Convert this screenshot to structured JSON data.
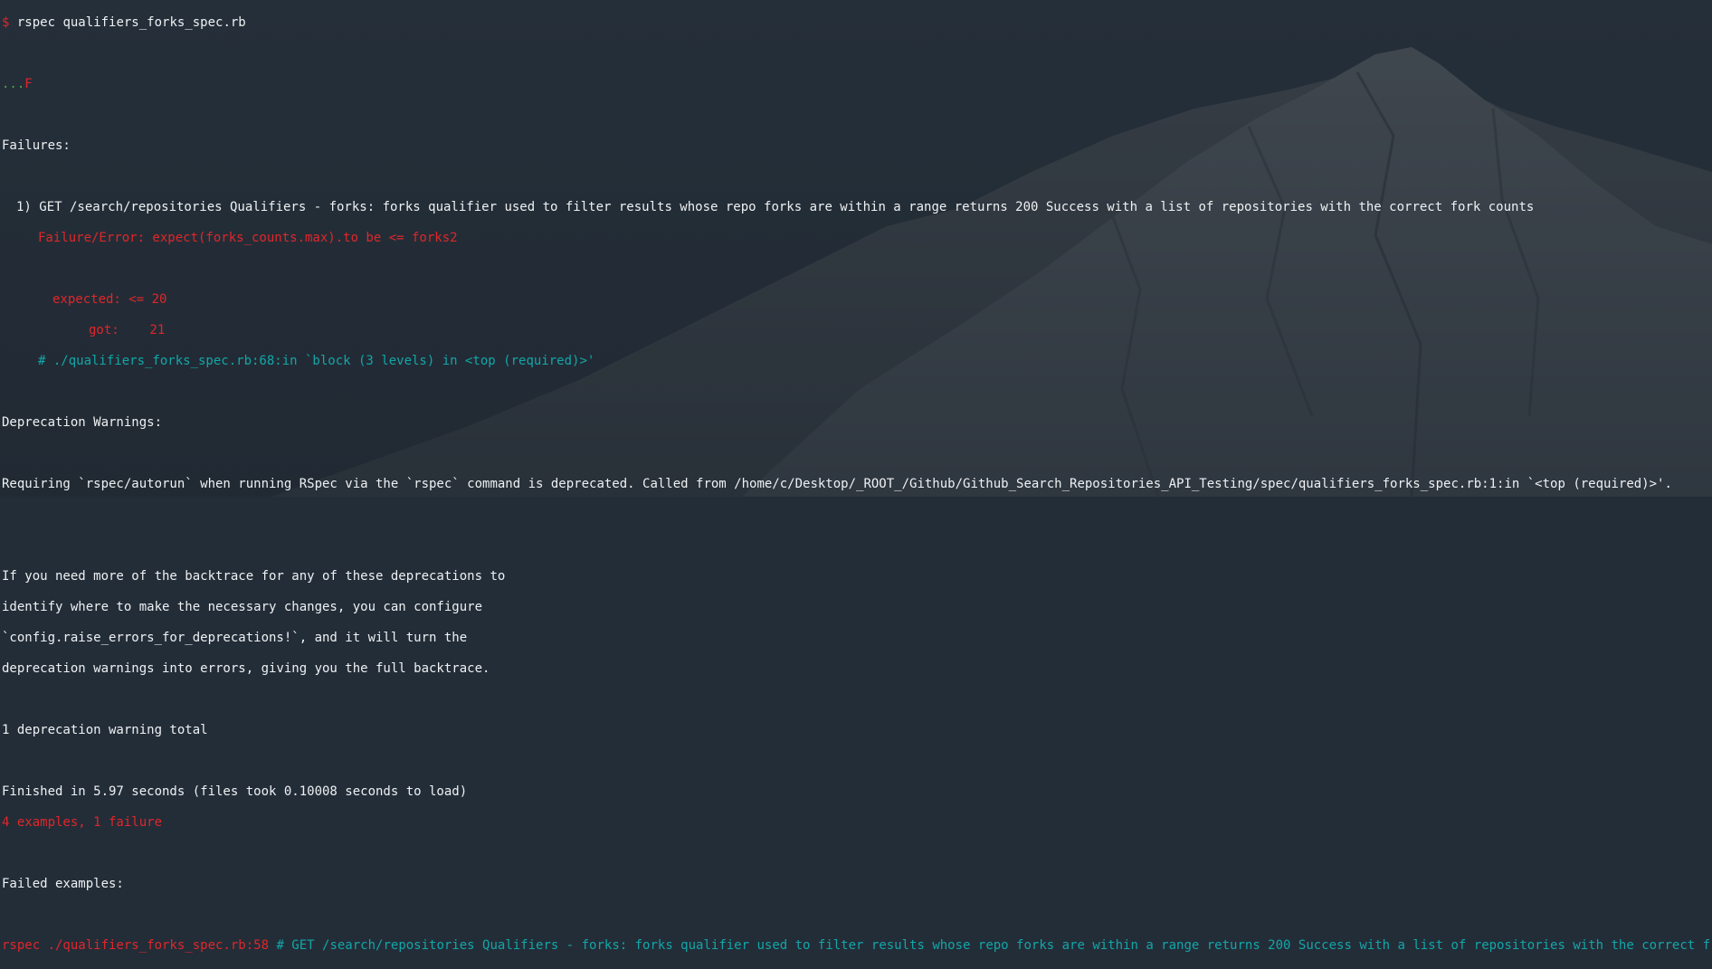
{
  "terminal": {
    "prompt": "$",
    "command": "rspec qualifiers_forks_spec.rb",
    "progress_pass": "...",
    "progress_fail": "F",
    "failures_heading": "Failures:",
    "failure": {
      "title": "1) GET /search/repositories Qualifiers - forks: forks qualifier used to filter results whose repo forks are within a range returns 200 Success with a list of repositories with the correct fork counts",
      "error": "Failure/Error: expect(forks_counts.max).to be <= forks2",
      "expected": "expected: <= 20",
      "got": "got:    21",
      "trace": "# ./qualifiers_forks_spec.rb:68:in `block (3 levels) in <top (required)>'"
    },
    "deprecation_heading": "Deprecation Warnings:",
    "deprecation_message": "Requiring `rspec/autorun` when running RSpec via the `rspec` command is deprecated. Called from /home/c/Desktop/_ROOT_/Github/Github_Search_Repositories_API_Testing/spec/qualifiers_forks_spec.rb:1:in `<top (required)>'.",
    "backtrace_help": [
      "If you need more of the backtrace for any of these deprecations to",
      "identify where to make the necessary changes, you can configure",
      "`config.raise_errors_for_deprecations!`, and it will turn the",
      "deprecation warnings into errors, giving you the full backtrace."
    ],
    "deprecation_total": "1 deprecation warning total",
    "finished": "Finished in 5.97 seconds (files took 0.10008 seconds to load)",
    "summary": "4 examples, 1 failure",
    "failed_examples_heading": "Failed examples:",
    "rerun_command": "rspec ./qualifiers_forks_spec.rb:58",
    "rerun_comment": "# GET /search/repositories Qualifiers - forks: forks qualifier used to filter results whose repo forks are within a range returns 200 Success with a list of repositories with the correct fork counts"
  },
  "colors": {
    "background": "#232d38",
    "text": "#eef1f3",
    "error": "#e0262a",
    "pass": "#54a640",
    "comment": "#13a6a8"
  }
}
